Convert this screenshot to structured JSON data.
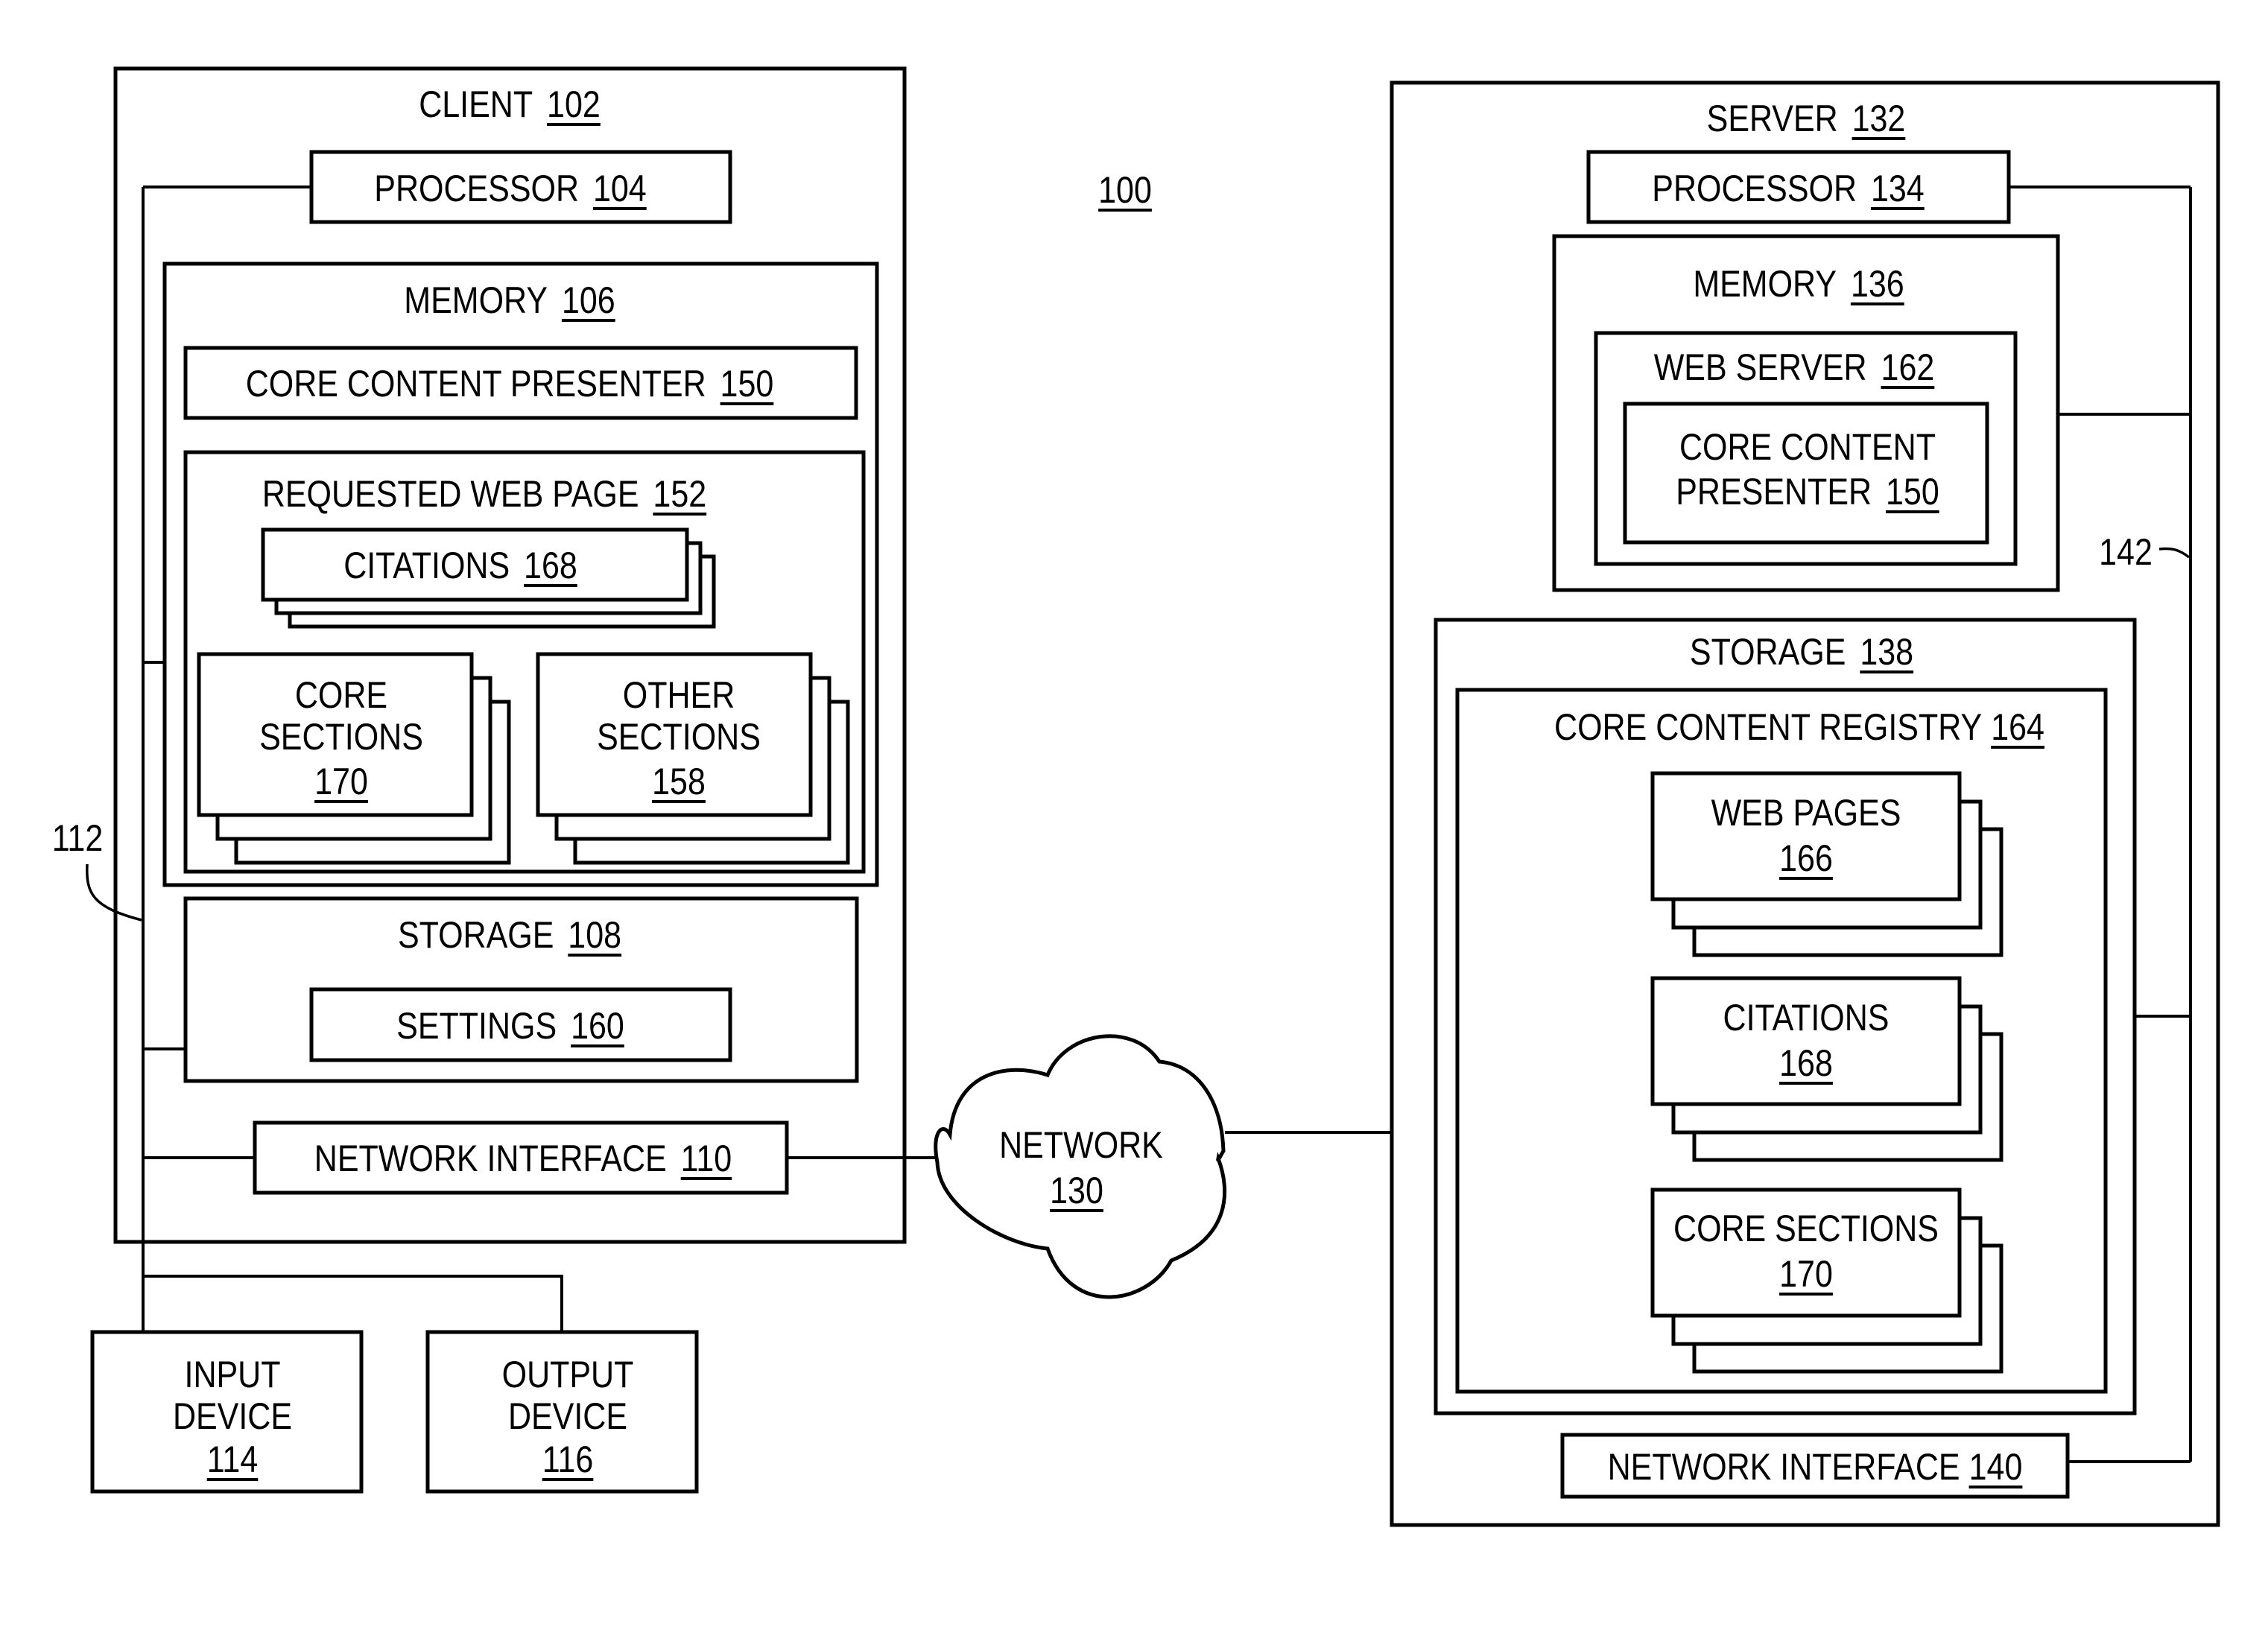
{
  "figure": {
    "ref": "100",
    "bus_labels": {
      "client_bus": "112",
      "server_bus": "142"
    }
  },
  "client": {
    "title": "CLIENT",
    "ref": "102",
    "processor": {
      "title": "PROCESSOR",
      "ref": "104"
    },
    "memory": {
      "title": "MEMORY",
      "ref": "106",
      "core_content_presenter": {
        "title": "CORE CONTENT PRESENTER",
        "ref": "150"
      },
      "requested_web_page": {
        "title": "REQUESTED WEB PAGE",
        "ref": "152",
        "citations": {
          "title": "CITATIONS",
          "ref": "168"
        },
        "core_sections": {
          "lines": [
            "CORE",
            "SECTIONS"
          ],
          "ref": "170"
        },
        "other_sections": {
          "lines": [
            "OTHER",
            "SECTIONS"
          ],
          "ref": "158"
        }
      }
    },
    "storage": {
      "title": "STORAGE",
      "ref": "108",
      "settings": {
        "title": "SETTINGS",
        "ref": "160"
      }
    },
    "network_interface": {
      "title": "NETWORK INTERFACE",
      "ref": "110"
    }
  },
  "input_device": {
    "lines": [
      "INPUT",
      "DEVICE"
    ],
    "ref": "114"
  },
  "output_device": {
    "lines": [
      "OUTPUT",
      "DEVICE"
    ],
    "ref": "116"
  },
  "network": {
    "title": "NETWORK",
    "ref": "130"
  },
  "server": {
    "title": "SERVER",
    "ref": "132",
    "processor": {
      "title": "PROCESSOR",
      "ref": "134"
    },
    "memory": {
      "title": "MEMORY",
      "ref": "136",
      "web_server": {
        "title": "WEB SERVER",
        "ref": "162",
        "core_content_presenter": {
          "lines": [
            "CORE CONTENT",
            "PRESENTER"
          ],
          "ref": "150"
        }
      }
    },
    "storage": {
      "title": "STORAGE",
      "ref": "138",
      "registry": {
        "title": "CORE CONTENT REGISTRY",
        "ref": "164",
        "web_pages": {
          "title": "WEB PAGES",
          "ref": "166"
        },
        "citations": {
          "title": "CITATIONS",
          "ref": "168"
        },
        "core_sections": {
          "title": "CORE SECTIONS",
          "ref": "170"
        }
      }
    },
    "network_interface": {
      "title": "NETWORK INTERFACE",
      "ref": "140"
    }
  }
}
